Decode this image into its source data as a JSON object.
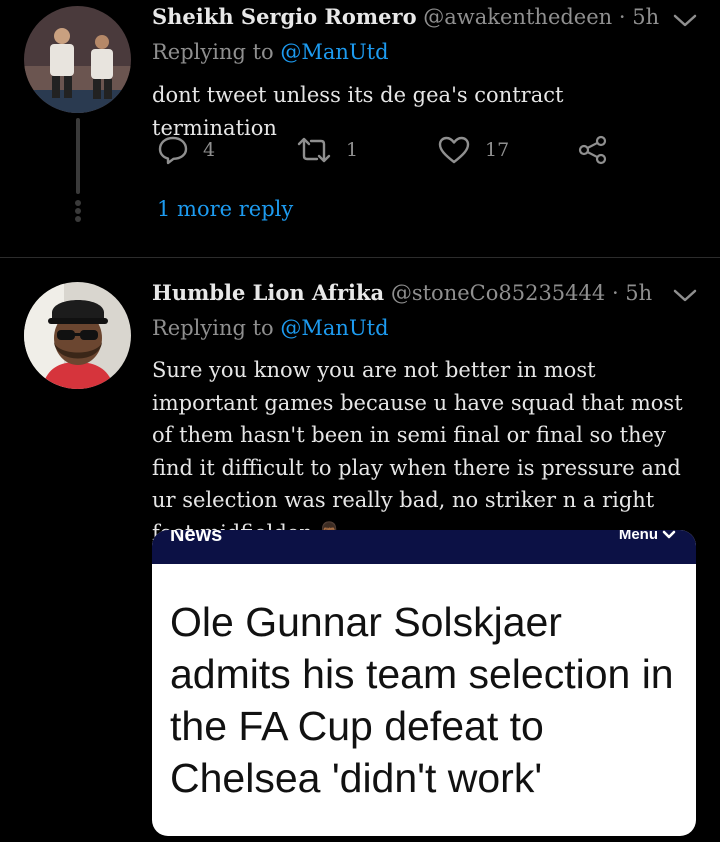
{
  "tweets": [
    {
      "name": "Sheikh Sergio Romero",
      "handle": "@awakenthedeen",
      "time": "· 5h",
      "reply_prefix": "Replying to",
      "reply_to": "@ManUtd",
      "text": "dont tweet unless its de gea's contract termination",
      "replies": "4",
      "retweets": "1",
      "likes": "17",
      "more_reply": "1 more reply"
    },
    {
      "name": "Humble Lion Afrika",
      "handle": "@stoneCo85235444",
      "time": "· 5h",
      "reply_prefix": "Replying to",
      "reply_to": "@ManUtd",
      "text": "Sure you know you are not better in most important games because u have squad that most of them hasn't been in semi final or final so they find it difficult to play when there is pressure and ur selection was really bad, no striker n a right foot midfielder 🤦🏾‍♂️",
      "card": {
        "brand": "News",
        "menu": "Menu",
        "headline": "Ole Gunnar Solskjaer admits his team selection in the FA Cup defeat to Chelsea 'didn't work'"
      }
    }
  ],
  "colors": {
    "link": "#1d9bf0",
    "muted": "#8f8f8f",
    "card_bar": "#0c1145"
  },
  "icons": [
    "reply-icon",
    "retweet-icon",
    "like-icon",
    "share-icon",
    "chevron-down-icon"
  ]
}
